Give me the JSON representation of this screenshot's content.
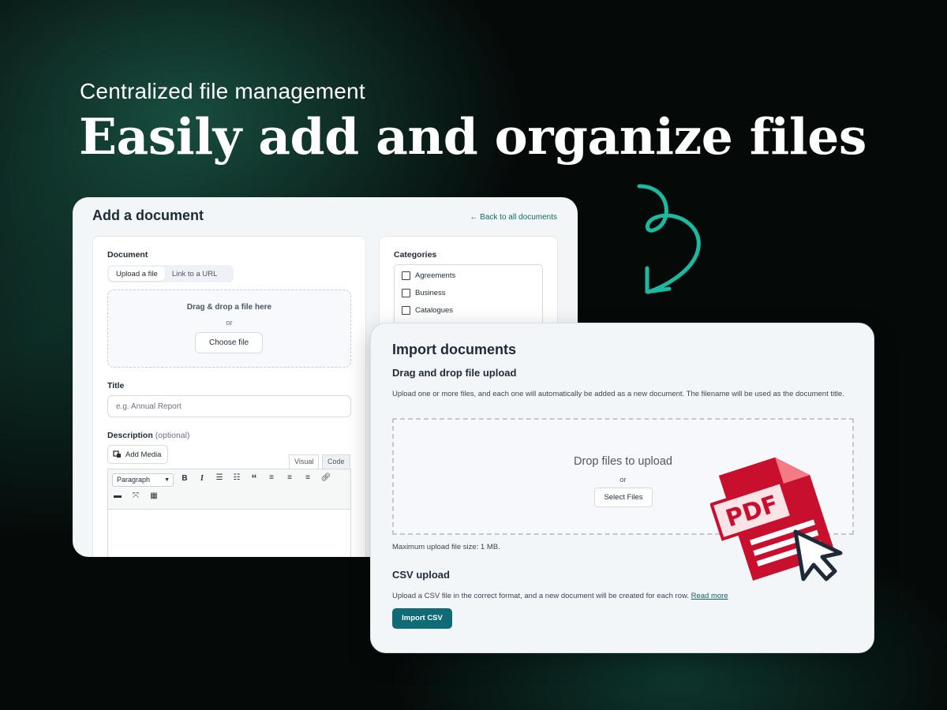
{
  "headline": {
    "subtitle": "Centralized file management",
    "title": "Easily add and organize files"
  },
  "add_document": {
    "title": "Add a document",
    "back_link": "← Back to all documents",
    "document_label": "Document",
    "tabs": [
      "Upload a file",
      "Link to a URL"
    ],
    "drop_text": "Drag & drop a file here",
    "or_text": "or",
    "choose_file": "Choose file",
    "title_label": "Title",
    "title_placeholder": "e.g. Annual Report",
    "description_label": "Description",
    "description_optional": "(optional)",
    "add_media": "Add Media",
    "editor_tabs": [
      "Visual",
      "Code"
    ],
    "paragraph_select": "Paragraph",
    "categories_label": "Categories",
    "categories": [
      "Agreements",
      "Business",
      "Catalogues"
    ]
  },
  "import_documents": {
    "title": "Import documents",
    "drag_title": "Drag and drop file upload",
    "drag_desc": "Upload one or more files, and each one will automatically be added as a new document. The filename will be used as the document title.",
    "drop_text": "Drop files to upload",
    "or_text": "or",
    "select_files": "Select Files",
    "max_size": "Maximum upload file size: 1 MB.",
    "csv_title": "CSV upload",
    "csv_desc": "Upload a CSV file in the correct format, and a new document will be created for each row.",
    "read_more": "Read more",
    "import_csv": "Import CSV"
  },
  "pdf_badge": "PDF",
  "colors": {
    "accent_teal": "#0f6b75",
    "arrow_teal": "#1bb9a0",
    "pdf_red": "#c8102e"
  }
}
